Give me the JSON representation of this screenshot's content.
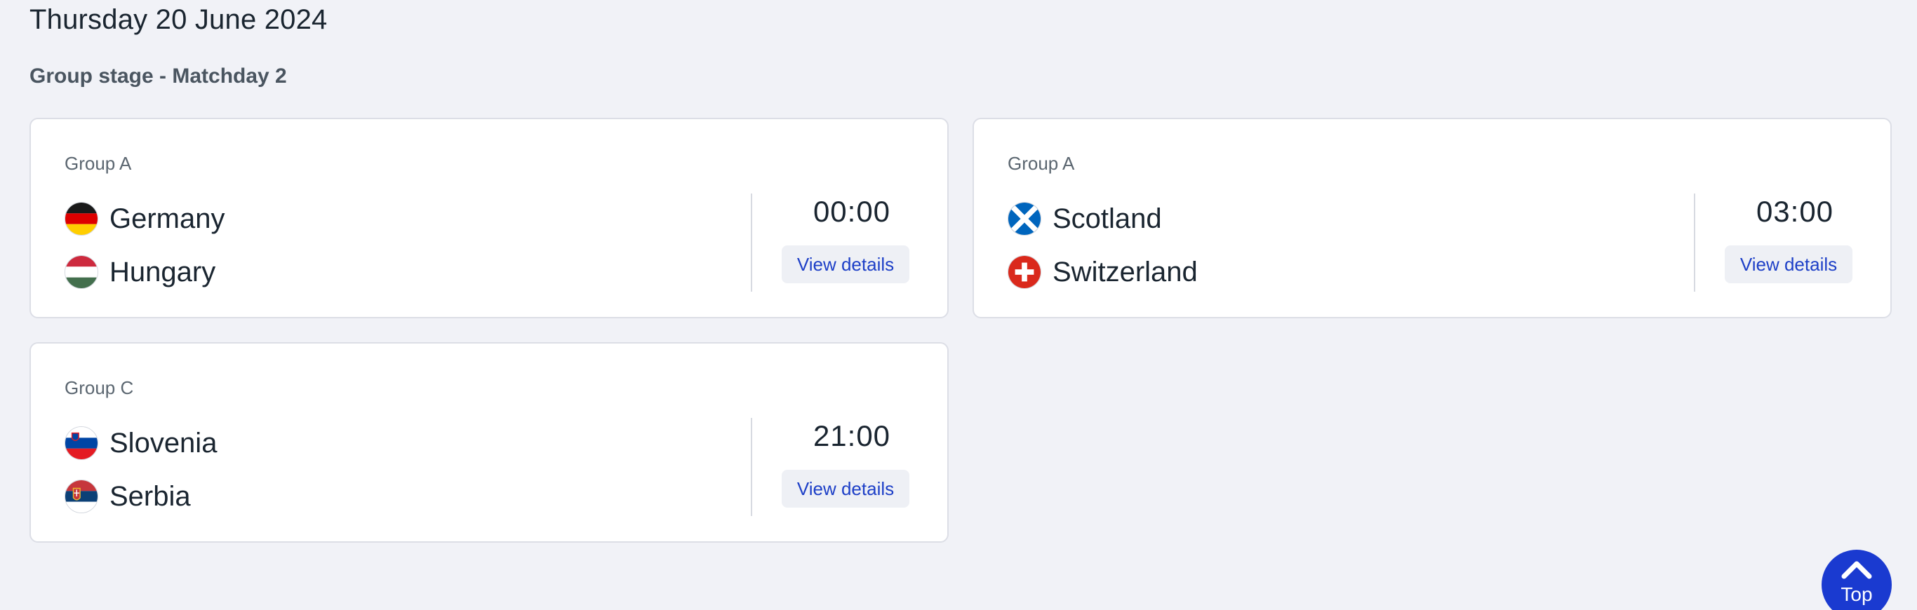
{
  "date_heading": "Thursday 20 June 2024",
  "stage_heading": "Group stage - Matchday 2",
  "matches": [
    {
      "group": "Group A",
      "home": {
        "name": "Germany",
        "flag_icon": "germany-flag-icon"
      },
      "away": {
        "name": "Hungary",
        "flag_icon": "hungary-flag-icon"
      },
      "time": "00:00",
      "details_label": "View details"
    },
    {
      "group": "Group A",
      "home": {
        "name": "Scotland",
        "flag_icon": "scotland-flag-icon"
      },
      "away": {
        "name": "Switzerland",
        "flag_icon": "switzerland-flag-icon"
      },
      "time": "03:00",
      "details_label": "View details"
    },
    {
      "group": "Group C",
      "home": {
        "name": "Slovenia",
        "flag_icon": "slovenia-flag-icon"
      },
      "away": {
        "name": "Serbia",
        "flag_icon": "serbia-flag-icon"
      },
      "time": "21:00",
      "details_label": "View details"
    }
  ],
  "top_button": {
    "label": "Top",
    "icon": "chevron-up-icon"
  },
  "colors": {
    "background": "#f1f2f7",
    "card": "#ffffff",
    "link": "#1d3fc7",
    "top_button": "#1a3ad0"
  }
}
